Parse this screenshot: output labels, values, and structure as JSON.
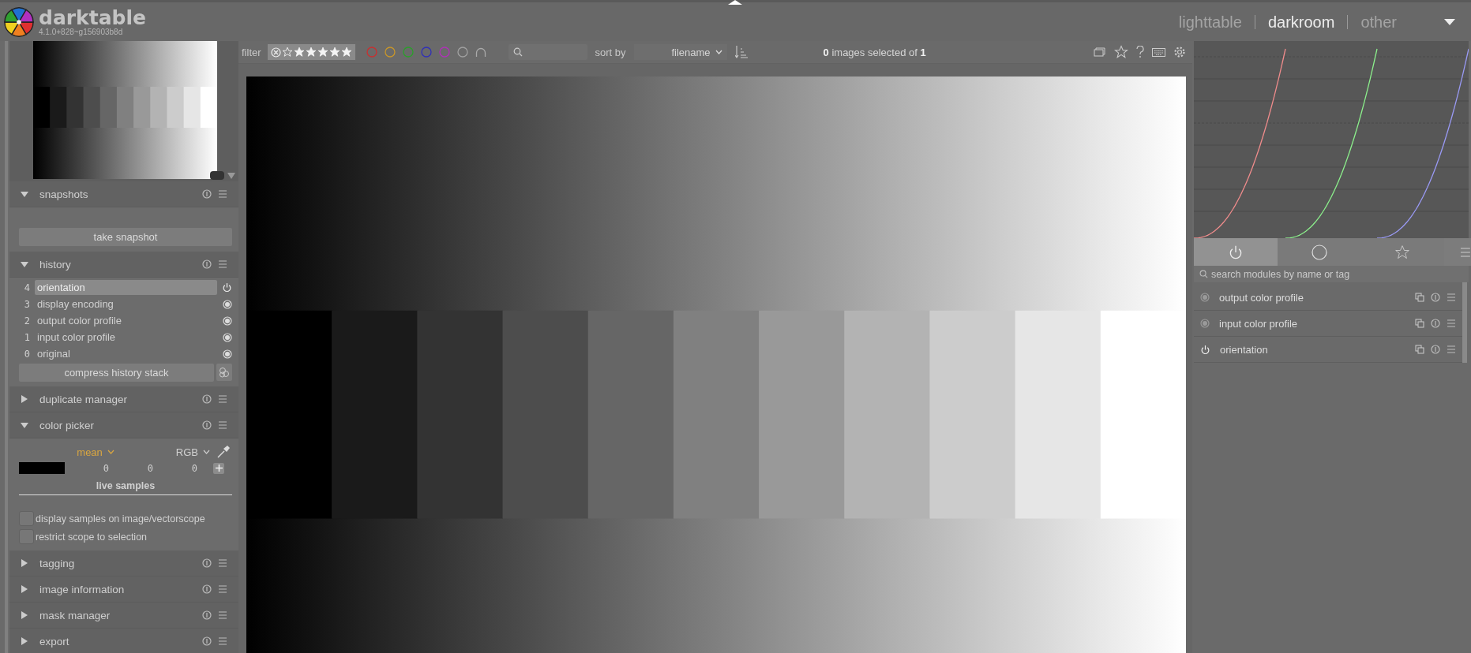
{
  "app": {
    "name": "darktable",
    "version": "4.1.0+828~g156903b8d"
  },
  "views": [
    {
      "label": "lighttable",
      "selected": false
    },
    {
      "label": "darkroom",
      "selected": true
    },
    {
      "label": "other",
      "selected": false
    }
  ],
  "left_modules": [
    {
      "title": "snapshots",
      "expanded": true,
      "kind": "snapshots",
      "button": "take snapshot"
    },
    {
      "title": "history",
      "expanded": true,
      "kind": "history",
      "items": [
        {
          "number": "4",
          "label": "orientation",
          "selected": true,
          "kind": "power"
        },
        {
          "number": "3",
          "label": "display encoding",
          "selected": false,
          "kind": "dot"
        },
        {
          "number": "2",
          "label": "output color profile",
          "selected": false,
          "kind": "dot"
        },
        {
          "number": "1",
          "label": "input color profile",
          "selected": false,
          "kind": "dot"
        },
        {
          "number": "0",
          "label": "original",
          "selected": false,
          "kind": "dot"
        }
      ],
      "button": "compress history stack"
    },
    {
      "title": "duplicate manager",
      "expanded": false
    },
    {
      "title": "color picker",
      "expanded": true,
      "kind": "color_picker",
      "statistic": "mean",
      "color_mode": "RGB",
      "values": [
        "0",
        "0",
        "0"
      ],
      "samples_title": "live samples",
      "options": [
        {
          "label": "display samples on image/vectorscope",
          "checked": false
        },
        {
          "label": "restrict scope to selection",
          "checked": false
        }
      ]
    },
    {
      "title": "tagging",
      "expanded": false
    },
    {
      "title": "image information",
      "expanded": false
    },
    {
      "title": "mask manager",
      "expanded": false
    },
    {
      "title": "export",
      "expanded": false
    }
  ],
  "filter_bar": {
    "label": "filter",
    "color_filters": [
      {
        "color": "#c83030"
      },
      {
        "color": "#c8962a"
      },
      {
        "color": "#2aa02a"
      },
      {
        "color": "#3030b8"
      },
      {
        "color": "#b030b8"
      },
      {
        "color": "#a0a0a0"
      }
    ],
    "sort_label": "sort by",
    "sort_value": "filename",
    "selection": "**0** images selected of **1**"
  },
  "module_tabs": [
    {
      "kind": "power",
      "selected": true
    },
    {
      "kind": "circle",
      "selected": false
    },
    {
      "kind": "star",
      "selected": false
    }
  ],
  "module_search": {
    "placeholder": "search modules by name or tag"
  },
  "modules": [
    {
      "label": "output color profile",
      "kind": "always_on"
    },
    {
      "label": "input color profile",
      "kind": "always_on"
    },
    {
      "label": "orientation",
      "kind": "toggle"
    }
  ]
}
